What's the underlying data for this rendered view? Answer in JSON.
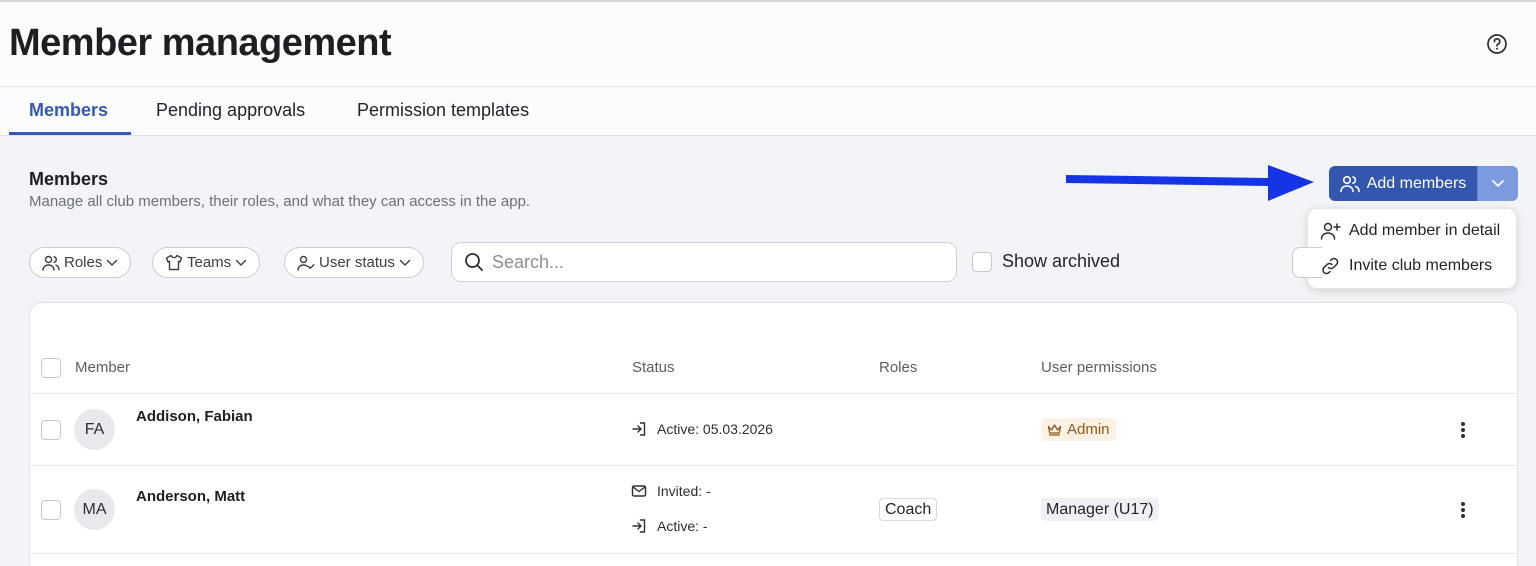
{
  "header": {
    "title": "Member management"
  },
  "tabs": [
    {
      "label": "Members",
      "active": true
    },
    {
      "label": "Pending approvals",
      "active": false
    },
    {
      "label": "Permission templates",
      "active": false
    }
  ],
  "section": {
    "title": "Members",
    "subtitle": "Manage all club members, their roles, and what they can access in the app."
  },
  "filters": {
    "roles": "Roles",
    "teams": "Teams",
    "user_status": "User status",
    "search_placeholder": "Search...",
    "show_archived": "Show archived"
  },
  "add_members": {
    "label": "Add members",
    "menu": [
      {
        "label": "Add member in detail",
        "icon": "user-plus-icon"
      },
      {
        "label": "Invite club members",
        "icon": "link-icon"
      }
    ]
  },
  "table": {
    "columns": [
      "Member",
      "Status",
      "Roles",
      "User permissions"
    ],
    "rows": [
      {
        "initials": "FA",
        "name": "Addison, Fabian",
        "active": "Active: 05.03.2026",
        "permission": "Admin"
      },
      {
        "initials": "MA",
        "name": "Anderson, Matt",
        "invited": "Invited: -",
        "active": "Active: -",
        "role": "Coach",
        "permission": "Manager (U17)"
      }
    ]
  },
  "colors": {
    "accent": "#3458b3",
    "button_primary": "#3357ae",
    "button_secondary": "#7b9ae0",
    "annotation_arrow": "#1534e6",
    "admin_badge_bg": "#fdf1e3"
  }
}
